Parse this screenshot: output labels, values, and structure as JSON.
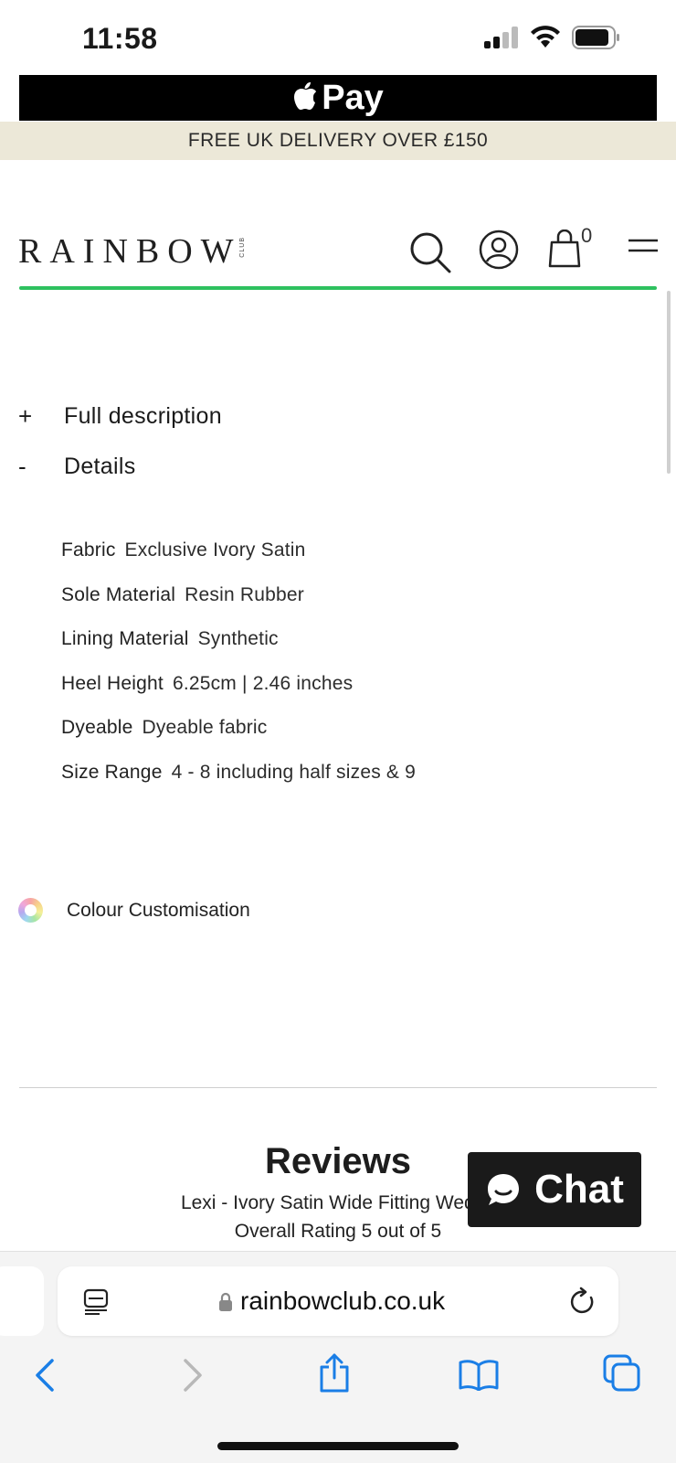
{
  "status_bar": {
    "time": "11:58"
  },
  "apple_pay": {
    "label": "Pay"
  },
  "promo": {
    "text": "FREE UK DELIVERY OVER £150"
  },
  "header": {
    "logo": "RAINBOW",
    "logo_small": "CLUB",
    "cart_count": "0"
  },
  "accordions": [
    {
      "sign": "+",
      "label": "Full description"
    },
    {
      "sign": "-",
      "label": "Details"
    }
  ],
  "details": [
    {
      "key": "Fabric",
      "value": "Exclusive Ivory Satin"
    },
    {
      "key": "Sole Material",
      "value": "Resin Rubber"
    },
    {
      "key": "Lining Material",
      "value": "Synthetic"
    },
    {
      "key": "Heel Height",
      "value": "6.25cm | 2.46 inches"
    },
    {
      "key": "Dyeable",
      "value": "Dyeable fabric"
    },
    {
      "key": "Size Range",
      "value": "4 - 8 including half sizes & 9"
    }
  ],
  "colour_customisation": {
    "label": "Colour Customisation"
  },
  "reviews": {
    "title": "Reviews",
    "product_line": "Lexi - Ivory Satin Wide Fitting Weddi",
    "rating_line": "Overall Rating 5 out of 5"
  },
  "chat": {
    "label": "Chat"
  },
  "browser": {
    "url": "rainbowclub.co.uk"
  },
  "colors": {
    "promo_bg": "#ece8d8",
    "accent_green": "#2ec15f",
    "safari_blue": "#1a7ee6"
  },
  "icons": [
    "signal-icon",
    "wifi-icon",
    "battery-icon",
    "apple-logo-icon",
    "search-icon",
    "account-icon",
    "bag-icon",
    "menu-icon",
    "colour-wheel-icon",
    "chat-bubble-icon",
    "reader-icon",
    "lock-icon",
    "reload-icon",
    "back-icon",
    "forward-icon",
    "share-icon",
    "bookmarks-icon",
    "tabs-icon"
  ]
}
